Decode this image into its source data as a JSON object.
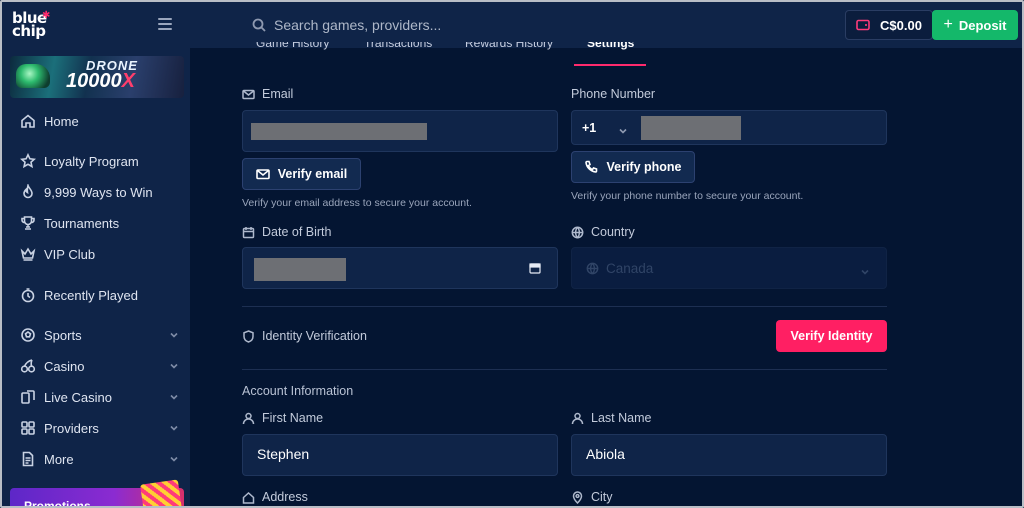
{
  "brand": {
    "line1": "blue",
    "line2": "chip"
  },
  "banner": {
    "line1": "DRONE",
    "line2_main": "10000",
    "line2_accent": "X"
  },
  "sidebar": {
    "items": [
      {
        "label": "Home",
        "icon": "home-icon"
      },
      {
        "label": "Loyalty Program",
        "icon": "star-icon"
      },
      {
        "label": "9,999 Ways to Win",
        "icon": "flame-icon"
      },
      {
        "label": "Tournaments",
        "icon": "trophy-icon"
      },
      {
        "label": "VIP Club",
        "icon": "crown-icon"
      },
      {
        "label": "Recently Played",
        "icon": "clock-icon"
      },
      {
        "label": "Sports",
        "icon": "ball-icon"
      },
      {
        "label": "Casino",
        "icon": "cherry-icon"
      },
      {
        "label": "Live Casino",
        "icon": "cards-icon"
      },
      {
        "label": "Providers",
        "icon": "grid-icon"
      },
      {
        "label": "More",
        "icon": "document-icon"
      }
    ],
    "promo_label": "Promotions"
  },
  "topbar": {
    "search_placeholder": "Search games, providers...",
    "balance": "C$0.00",
    "deposit_label": "Deposit"
  },
  "tabs": [
    {
      "label": "Game History"
    },
    {
      "label": "Transactions"
    },
    {
      "label": "Rewards History"
    },
    {
      "label": "Settings",
      "active": true
    }
  ],
  "form": {
    "email_label": "Email",
    "verify_email_label": "Verify email",
    "email_hint": "Verify your email address to secure your account.",
    "phone_label": "Phone Number",
    "phone_code": "+1",
    "verify_phone_label": "Verify phone",
    "phone_hint": "Verify your phone number to secure your account.",
    "dob_label": "Date of Birth",
    "country_label": "Country",
    "country_value": "Canada",
    "identity_label": "Identity Verification",
    "verify_identity_label": "Verify Identity",
    "account_info_title": "Account Information",
    "first_name_label": "First Name",
    "first_name_value": "Stephen",
    "last_name_label": "Last Name",
    "last_name_value": "Abiola",
    "address_label": "Address",
    "city_label": "City"
  },
  "colors": {
    "background": "#041532",
    "panel": "#0f2448",
    "accent": "#ff1f63",
    "deposit": "#14b86a"
  }
}
